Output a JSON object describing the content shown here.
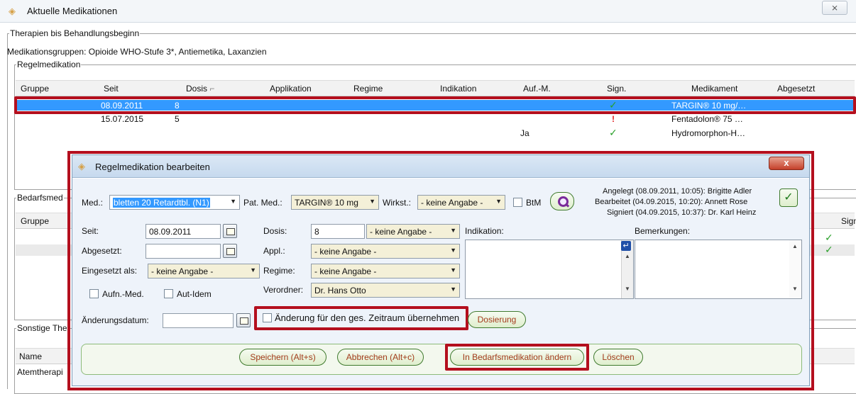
{
  "window": {
    "title": "Aktuelle Medikationen",
    "close_glyph": "⨯"
  },
  "therapien": {
    "legend": "Therapien bis Behandlungsbeginn",
    "groups_text": "Medikationsgruppen: Opioide WHO-Stufe 3*, Antiemetika, Laxanzien"
  },
  "regel": {
    "legend": "Regelmedikation",
    "columns": [
      "Gruppe",
      "Seit",
      "Dosis",
      "Applikation",
      "Regime",
      "Indikation",
      "Auf.-M.",
      "Sign.",
      "Medikament",
      "Abgesetzt"
    ],
    "sort_glyph": "⌐",
    "rows": [
      {
        "seit": "08.09.2011",
        "dosis": "8",
        "aufm": "",
        "sign": "✓",
        "medikament": "TARGIN® 10 mg/…",
        "selected": true
      },
      {
        "seit": "15.07.2015",
        "dosis": "5",
        "aufm": "",
        "sign": "!",
        "medikament": "Fentadolon® 75 …",
        "selected": false
      },
      {
        "seit": "",
        "dosis": "",
        "aufm": "Ja",
        "sign": "✓",
        "medikament": "Hydromorphon-H…",
        "selected": false
      }
    ]
  },
  "bedarf": {
    "legend": "Bedarfsmed",
    "col_gruppe": "Gruppe",
    "col_sign": "Sign.",
    "checks": [
      "✓",
      "✓"
    ]
  },
  "sonstige": {
    "legend": "Sonstige The",
    "col_name": "Name",
    "row1": "Atemtherapi"
  },
  "dialog": {
    "title": "Regelmedikation bearbeiten",
    "close_glyph": "x",
    "med_label": "Med.:",
    "med_value": "bletten 20 Retardtbl. (N1)",
    "patmed_label": "Pat. Med.:",
    "patmed_value": "TARGIN® 10 mg",
    "wirkst_label": "Wirkst.:",
    "wirkst_value": "- keine Angabe -",
    "btm_label": "BtM",
    "info_angelegt": "Angelegt (08.09.2011, 10:05): Brigitte Adler",
    "info_bearbeitet": "Bearbeitet (04.09.2015, 10:20): Annett Rose",
    "info_signiert": "Signiert (04.09.2015, 10:37): Dr. Karl Heinz",
    "seit_label": "Seit:",
    "seit_value": "08.09.2011",
    "abgesetzt_label": "Abgesetzt:",
    "abgesetzt_value": "",
    "eingesetzt_label": "Eingesetzt als:",
    "eingesetzt_value": "- keine Angabe -",
    "aufn_label": "Aufn.-Med.",
    "autidem_label": "Aut-Idem",
    "dosis_label": "Dosis:",
    "dosis_value": "8",
    "dosis_unit": "- keine Angabe -",
    "appl_label": "Appl.:",
    "appl_value": "- keine Angabe -",
    "regime_label": "Regime:",
    "regime_value": "- keine Angabe -",
    "verordner_label": "Verordner:",
    "verordner_value": "Dr. Hans Otto",
    "indikation_label": "Indikation:",
    "bemerkungen_label": "Bemerkungen:",
    "aenderungsdatum_label": "Änderungsdatum:",
    "aenderungsdatum_value": "",
    "zeitraum_label": "Änderung für den ges. Zeitraum übernehmen",
    "dosierung_label": "Dosierung",
    "speichern_label": "Speichern (Alt+s)",
    "abbrechen_label": "Abbrechen (Alt+c)",
    "bedarf_label": "In Bedarfsmedikation ändern",
    "loeschen_label": "Löschen"
  },
  "icons": {
    "app_logo": "◈",
    "dropdown_arrow": "▼",
    "scroll_up": "▲",
    "scroll_down": "▼",
    "nav_arrow": "↵",
    "ok_check": "✓"
  },
  "colors": {
    "selection": "#3399ff",
    "highlight_red": "#b40f1e",
    "button_text": "#a33b1c",
    "sign_green": "#2aa02a"
  }
}
